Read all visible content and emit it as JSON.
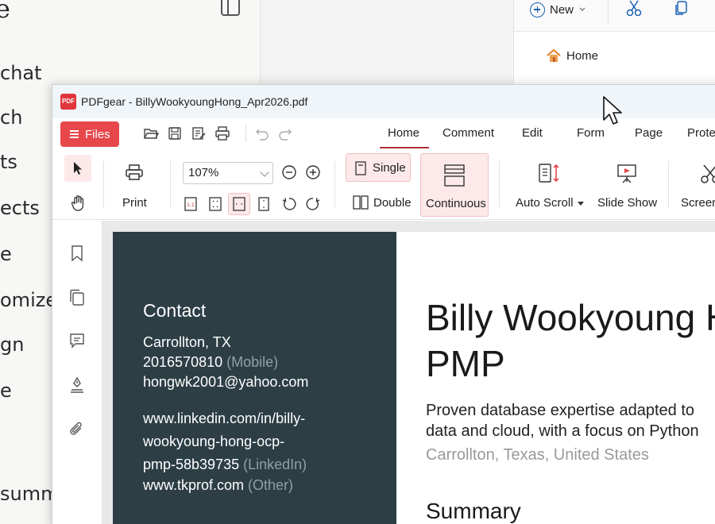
{
  "bg_left": {
    "title_fragment": "e",
    "items": [
      {
        "label": "chat"
      },
      {
        "label": "ch"
      },
      {
        "label": "ts"
      },
      {
        "label": "ects"
      },
      {
        "label": "e"
      },
      {
        "label": "omize"
      },
      {
        "label": "gn"
      },
      {
        "label": "e"
      },
      {
        "label": "summa"
      }
    ]
  },
  "bg_right": {
    "new_label": "New",
    "home_label": "Home"
  },
  "window": {
    "title": "PDFgear - BillyWookyoungHong_Apr2026.pdf",
    "app_icon_text": "PDF"
  },
  "menu": {
    "files_label": "Files",
    "tabs": [
      "Home",
      "Comment",
      "Edit",
      "Form",
      "Page",
      "Prote"
    ]
  },
  "toolbar": {
    "print_label": "Print",
    "zoom_value": "107%",
    "single_label": "Single",
    "double_label": "Double",
    "continuous_label": "Continuous",
    "autoscroll_label": "Auto Scroll",
    "slideshow_label": "Slide Show",
    "screen_label": "Screen"
  },
  "document": {
    "contact_heading": "Contact",
    "city": "Carrollton, TX",
    "phone": "2016570810",
    "phone_type": "(Mobile)",
    "email": "hongwk2001@yahoo.com",
    "linkedin_1": "www.linkedin.com/in/billy-",
    "linkedin_2": "wookyoung-hong-ocp-",
    "linkedin_3": "pmp-58b39735",
    "linkedin_type": "(LinkedIn)",
    "website": "www.tkprof.com",
    "website_type": "(Other)",
    "name": "Billy Wookyoung H",
    "credential": "PMP",
    "headline_1": "Proven database expertise adapted to",
    "headline_2": "data and cloud, with a focus on Python",
    "location": "Carrollton, Texas, United States",
    "summary_heading": "Summary"
  },
  "colors": {
    "accent_red": "#e7474b",
    "sidebar_dark": "#2d3e45",
    "selected_pink": "#fde9ea"
  }
}
